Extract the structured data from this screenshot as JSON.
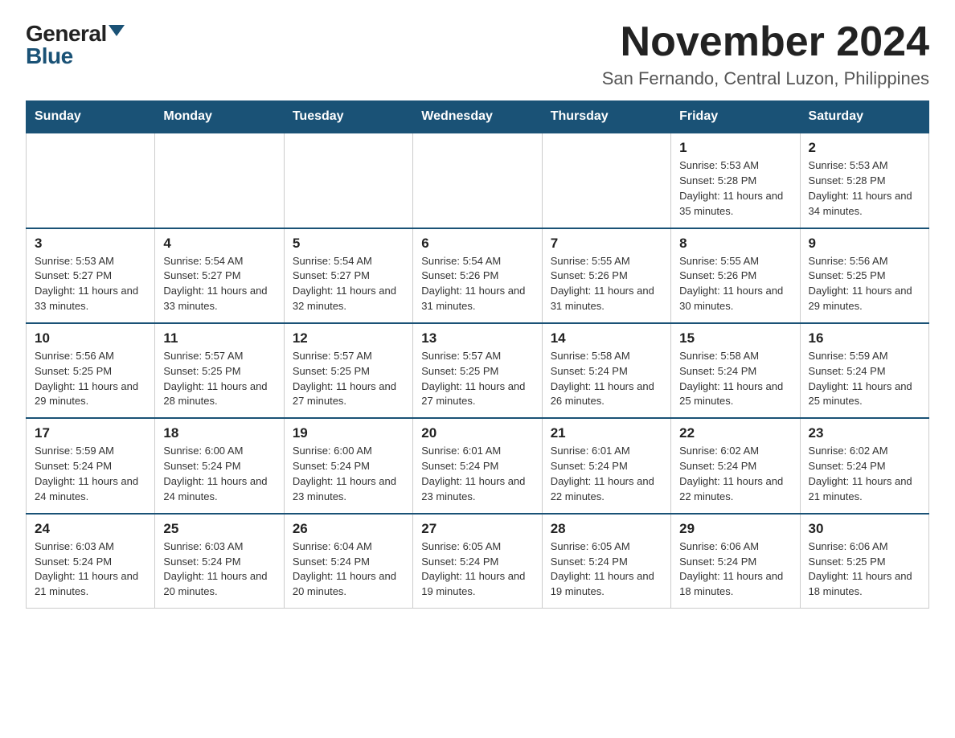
{
  "logo": {
    "general": "General",
    "blue": "Blue"
  },
  "title": {
    "month": "November 2024",
    "location": "San Fernando, Central Luzon, Philippines"
  },
  "days_of_week": [
    "Sunday",
    "Monday",
    "Tuesday",
    "Wednesday",
    "Thursday",
    "Friday",
    "Saturday"
  ],
  "weeks": [
    [
      {
        "day": "",
        "info": ""
      },
      {
        "day": "",
        "info": ""
      },
      {
        "day": "",
        "info": ""
      },
      {
        "day": "",
        "info": ""
      },
      {
        "day": "",
        "info": ""
      },
      {
        "day": "1",
        "info": "Sunrise: 5:53 AM\nSunset: 5:28 PM\nDaylight: 11 hours and 35 minutes."
      },
      {
        "day": "2",
        "info": "Sunrise: 5:53 AM\nSunset: 5:28 PM\nDaylight: 11 hours and 34 minutes."
      }
    ],
    [
      {
        "day": "3",
        "info": "Sunrise: 5:53 AM\nSunset: 5:27 PM\nDaylight: 11 hours and 33 minutes."
      },
      {
        "day": "4",
        "info": "Sunrise: 5:54 AM\nSunset: 5:27 PM\nDaylight: 11 hours and 33 minutes."
      },
      {
        "day": "5",
        "info": "Sunrise: 5:54 AM\nSunset: 5:27 PM\nDaylight: 11 hours and 32 minutes."
      },
      {
        "day": "6",
        "info": "Sunrise: 5:54 AM\nSunset: 5:26 PM\nDaylight: 11 hours and 31 minutes."
      },
      {
        "day": "7",
        "info": "Sunrise: 5:55 AM\nSunset: 5:26 PM\nDaylight: 11 hours and 31 minutes."
      },
      {
        "day": "8",
        "info": "Sunrise: 5:55 AM\nSunset: 5:26 PM\nDaylight: 11 hours and 30 minutes."
      },
      {
        "day": "9",
        "info": "Sunrise: 5:56 AM\nSunset: 5:25 PM\nDaylight: 11 hours and 29 minutes."
      }
    ],
    [
      {
        "day": "10",
        "info": "Sunrise: 5:56 AM\nSunset: 5:25 PM\nDaylight: 11 hours and 29 minutes."
      },
      {
        "day": "11",
        "info": "Sunrise: 5:57 AM\nSunset: 5:25 PM\nDaylight: 11 hours and 28 minutes."
      },
      {
        "day": "12",
        "info": "Sunrise: 5:57 AM\nSunset: 5:25 PM\nDaylight: 11 hours and 27 minutes."
      },
      {
        "day": "13",
        "info": "Sunrise: 5:57 AM\nSunset: 5:25 PM\nDaylight: 11 hours and 27 minutes."
      },
      {
        "day": "14",
        "info": "Sunrise: 5:58 AM\nSunset: 5:24 PM\nDaylight: 11 hours and 26 minutes."
      },
      {
        "day": "15",
        "info": "Sunrise: 5:58 AM\nSunset: 5:24 PM\nDaylight: 11 hours and 25 minutes."
      },
      {
        "day": "16",
        "info": "Sunrise: 5:59 AM\nSunset: 5:24 PM\nDaylight: 11 hours and 25 minutes."
      }
    ],
    [
      {
        "day": "17",
        "info": "Sunrise: 5:59 AM\nSunset: 5:24 PM\nDaylight: 11 hours and 24 minutes."
      },
      {
        "day": "18",
        "info": "Sunrise: 6:00 AM\nSunset: 5:24 PM\nDaylight: 11 hours and 24 minutes."
      },
      {
        "day": "19",
        "info": "Sunrise: 6:00 AM\nSunset: 5:24 PM\nDaylight: 11 hours and 23 minutes."
      },
      {
        "day": "20",
        "info": "Sunrise: 6:01 AM\nSunset: 5:24 PM\nDaylight: 11 hours and 23 minutes."
      },
      {
        "day": "21",
        "info": "Sunrise: 6:01 AM\nSunset: 5:24 PM\nDaylight: 11 hours and 22 minutes."
      },
      {
        "day": "22",
        "info": "Sunrise: 6:02 AM\nSunset: 5:24 PM\nDaylight: 11 hours and 22 minutes."
      },
      {
        "day": "23",
        "info": "Sunrise: 6:02 AM\nSunset: 5:24 PM\nDaylight: 11 hours and 21 minutes."
      }
    ],
    [
      {
        "day": "24",
        "info": "Sunrise: 6:03 AM\nSunset: 5:24 PM\nDaylight: 11 hours and 21 minutes."
      },
      {
        "day": "25",
        "info": "Sunrise: 6:03 AM\nSunset: 5:24 PM\nDaylight: 11 hours and 20 minutes."
      },
      {
        "day": "26",
        "info": "Sunrise: 6:04 AM\nSunset: 5:24 PM\nDaylight: 11 hours and 20 minutes."
      },
      {
        "day": "27",
        "info": "Sunrise: 6:05 AM\nSunset: 5:24 PM\nDaylight: 11 hours and 19 minutes."
      },
      {
        "day": "28",
        "info": "Sunrise: 6:05 AM\nSunset: 5:24 PM\nDaylight: 11 hours and 19 minutes."
      },
      {
        "day": "29",
        "info": "Sunrise: 6:06 AM\nSunset: 5:24 PM\nDaylight: 11 hours and 18 minutes."
      },
      {
        "day": "30",
        "info": "Sunrise: 6:06 AM\nSunset: 5:25 PM\nDaylight: 11 hours and 18 minutes."
      }
    ]
  ]
}
